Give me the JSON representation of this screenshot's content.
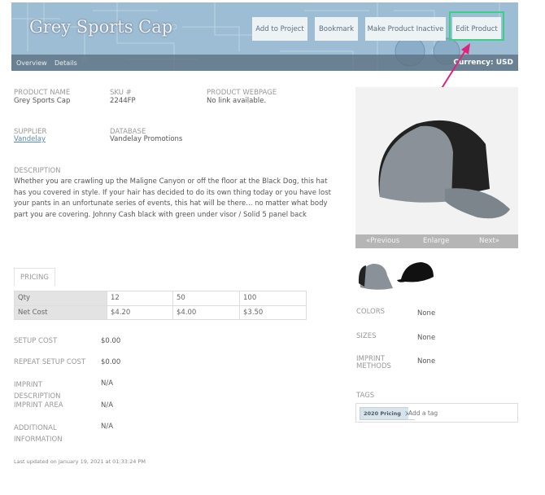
{
  "header": {
    "title": "Grey Sports Cap",
    "buttons": [
      "Add to Project",
      "Bookmark",
      "Make Product Inactive",
      "Edit Product"
    ],
    "nav": [
      "Overview",
      "Details"
    ],
    "currency": "Currency:  USD"
  },
  "fields": {
    "product_name": {
      "label": "PRODUCT NAME",
      "value": "Grey Sports Cap"
    },
    "sku": {
      "label": "SKU #",
      "value": "2244FP"
    },
    "webpage": {
      "label": "PRODUCT WEBPAGE",
      "value": "No link available."
    },
    "supplier": {
      "label": "SUPPLIER",
      "value": "Vandelay"
    },
    "database": {
      "label": "DATABASE",
      "value": "Vandelay Promotions"
    },
    "description": {
      "label": "DESCRIPTION",
      "value": "Whether you are crawling up the Maligne Canyon or off the floor at the Black Dog, this hat has you covered in style. If your hair has decided to do its own thing today or you have lost your pants in an unfortunate series of events, this hat will be there... no matter what body part you are covering. Johnny Cash black with green under visor / Solid 5 panel back"
    }
  },
  "pricing": {
    "tab": "PRICING",
    "rows": [
      [
        "Qty",
        "12",
        "50",
        "100"
      ],
      [
        "Net Cost",
        "$4.20",
        "$4.00",
        "$3.50"
      ]
    ]
  },
  "costs": [
    {
      "label": "SETUP COST",
      "value": "$0.00"
    },
    {
      "label": "REPEAT SETUP COST",
      "value": "$0.00"
    },
    {
      "label": "IMPRINT DESCRIPTION",
      "value": "N/A"
    },
    {
      "label": "IMPRINT AREA",
      "value": "N/A"
    },
    {
      "label": "ADDITIONAL INFORMATION",
      "value": "N/A"
    }
  ],
  "last_updated": "Last updated on January 19, 2021 at 01:33:24 PM",
  "gallery": {
    "previous": "«Previous",
    "enlarge": "Enlarge",
    "next": "Next»"
  },
  "attributes": [
    {
      "label": "COLORS",
      "value": "None"
    },
    {
      "label": "SIZES",
      "value": "None"
    },
    {
      "label": "IMPRINT METHODS",
      "value": "None"
    }
  ],
  "tags": {
    "label": "TAGS",
    "items": [
      "2020 Pricing"
    ],
    "placeholder": "Add a tag"
  },
  "colors": {
    "highlight": "#3ccf8a",
    "arrow": "#e0237a",
    "header": "#9dbdd4"
  }
}
